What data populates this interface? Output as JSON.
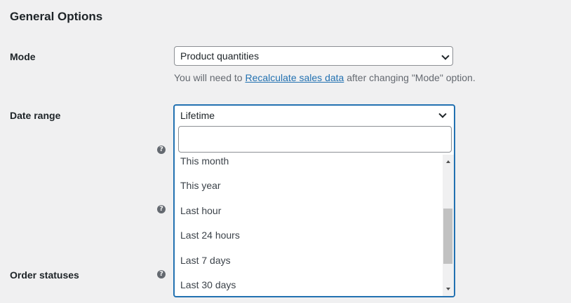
{
  "page": {
    "title": "General Options"
  },
  "mode": {
    "label": "Mode",
    "value": "Product quantities",
    "desc_before": "You will need to ",
    "desc_link": "Recalculate sales data",
    "desc_after": " after changing \"Mode\" option."
  },
  "date_range": {
    "label": "Date range",
    "value": "Lifetime",
    "search_value": "",
    "options": [
      "This month",
      "This year",
      "Last hour",
      "Last 24 hours",
      "Last 7 days",
      "Last 30 days"
    ]
  },
  "order_statuses": {
    "label": "Order statuses"
  },
  "help_glyph": "?",
  "icons": [
    "help-icon",
    "chevron-down-icon",
    "scroll-up-arrow-icon",
    "scroll-down-arrow-icon"
  ],
  "colors": {
    "accent": "#2271b1",
    "background": "#f0f0f1",
    "text": "#1d2327",
    "muted": "#646970"
  }
}
